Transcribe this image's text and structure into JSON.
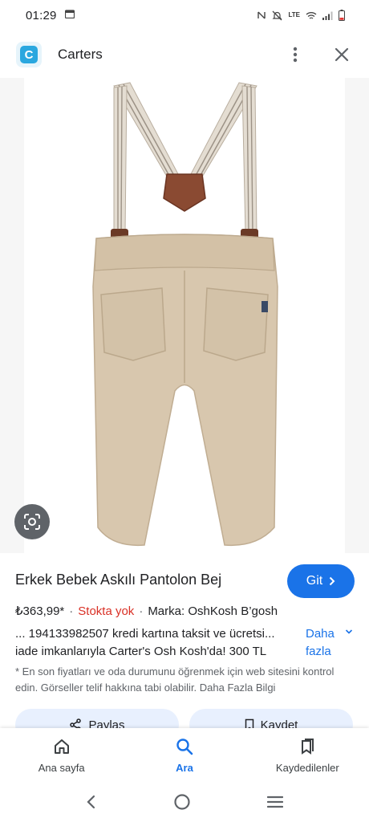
{
  "status_bar": {
    "time": "01:29",
    "network_label": "LTE"
  },
  "app": {
    "title": "Carters",
    "logo_letter": "C"
  },
  "product": {
    "title": "Erkek Bebek Askılı Pantolon Bej",
    "visit_label": "Git",
    "price": "₺363,99*",
    "stock": "Stokta yok",
    "brand": "Marka: OshKosh B’gosh",
    "description_line1": "... 194133982507 kredi kartına taksit ve ücretsi...",
    "description_line2": "iade imkanlarıyla Carter's Osh Kosh'da! 300 TL",
    "more_label_1": "Daha",
    "more_label_2": "fazla",
    "disclaimer": "* En son fiyatları ve oda durumunu öğrenmek için web sitesini kontrol edin. Görseller telif hakkına tabi olabilir. Daha Fazla Bilgi"
  },
  "actions": {
    "share_label": "Paylaş",
    "save_label": "Kaydet"
  },
  "bottom_nav": {
    "items": [
      {
        "label": "Ana sayfa",
        "icon": "home-icon"
      },
      {
        "label": "Ara",
        "icon": "search-icon",
        "active": true
      },
      {
        "label": "Kaydedilenler",
        "icon": "bookmarks-icon"
      }
    ]
  },
  "colors": {
    "accent": "#1a73e8",
    "stock_red": "#d93025",
    "chip_bg": "#e8f0fe",
    "pants": "#d8c7ae"
  }
}
